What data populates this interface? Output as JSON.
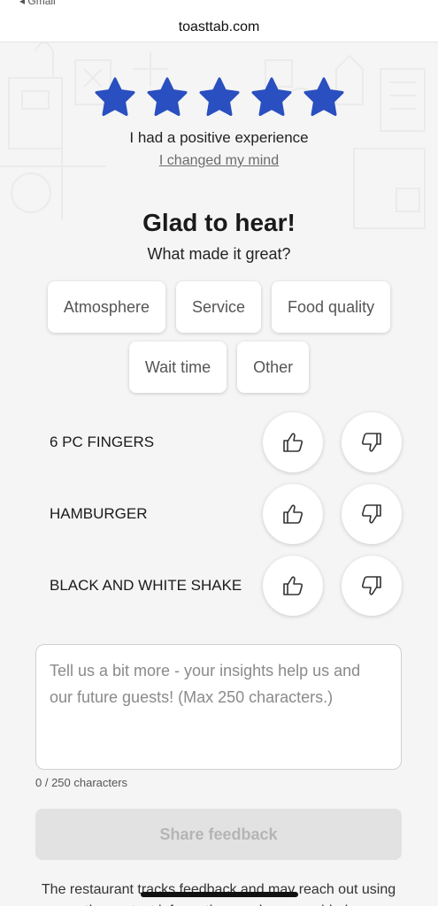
{
  "browser": {
    "back_label": "◂ Gmail",
    "domain": "toasttab.com"
  },
  "rating": {
    "stars_selected": 5,
    "stars_total": 5,
    "star_color": "#2a4fc0",
    "summary": "I had a positive experience",
    "change_link": "I changed my mind"
  },
  "feedback": {
    "heading": "Glad to hear!",
    "subheading": "What made it great?",
    "chips_row1": [
      "Atmosphere",
      "Service",
      "Food quality"
    ],
    "chips_row2": [
      "Wait time",
      "Other"
    ]
  },
  "items": [
    {
      "name": "6 PC FINGERS"
    },
    {
      "name": "HAMBURGER"
    },
    {
      "name": "BLACK AND WHITE SHAKE"
    }
  ],
  "comment": {
    "placeholder": "Tell us a bit more - your insights help us and our future guests! (Max 250 characters.)",
    "counter": "0 / 250 characters"
  },
  "actions": {
    "share_label": "Share feedback"
  },
  "footer": {
    "text": "The restaurant tracks feedback and may reach out using the contact information you have provided."
  }
}
